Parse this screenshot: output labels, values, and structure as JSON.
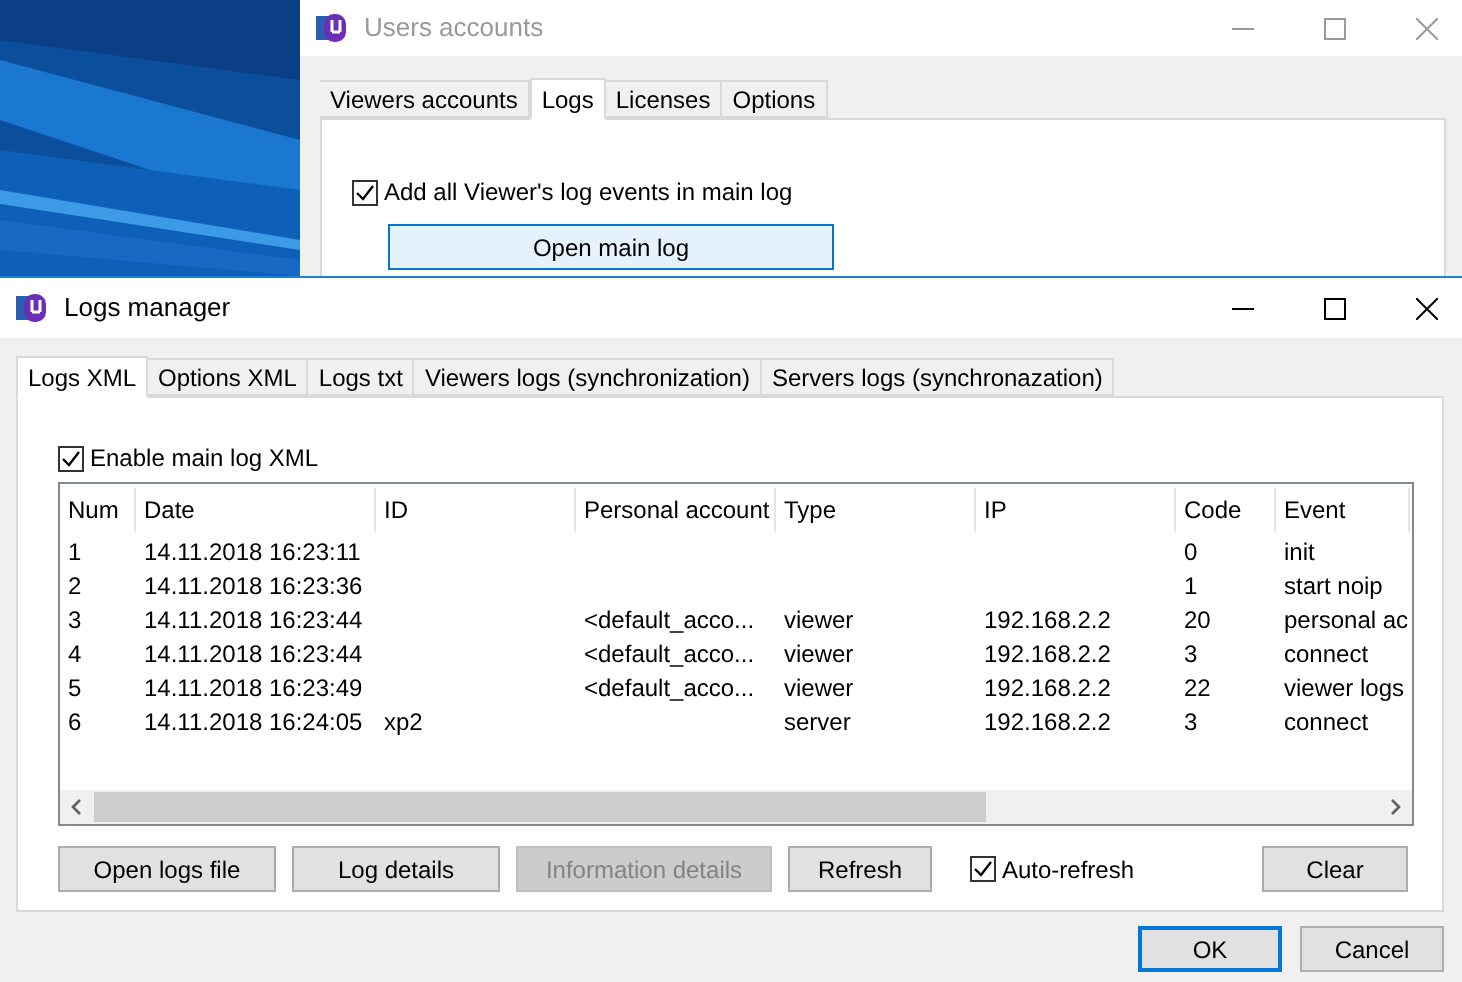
{
  "background_window": {
    "title": "Users accounts",
    "tabs": [
      {
        "label": "Viewers accounts",
        "selected": false
      },
      {
        "label": "Logs",
        "selected": true
      },
      {
        "label": "Licenses",
        "selected": false
      },
      {
        "label": "Options",
        "selected": false
      }
    ],
    "checkbox": {
      "label": "Add all Viewer's log events in main log",
      "checked": true
    },
    "button": "Open main log"
  },
  "window": {
    "title": "Logs manager",
    "tabs": [
      {
        "label": "Logs XML",
        "selected": true
      },
      {
        "label": "Options XML",
        "selected": false
      },
      {
        "label": "Logs txt",
        "selected": false
      },
      {
        "label": "Viewers logs (synchronization)",
        "selected": false
      },
      {
        "label": "Servers logs (synchronazation)",
        "selected": false
      }
    ],
    "enable_checkbox": {
      "label": "Enable main log XML",
      "checked": true
    },
    "table": {
      "columns": [
        "Num",
        "Date",
        "ID",
        "Personal account",
        "Type",
        "IP",
        "Code",
        "Event"
      ],
      "rows": [
        [
          "1",
          "14.11.2018 16:23:11",
          null,
          null,
          null,
          null,
          "0",
          "init"
        ],
        [
          "2",
          "14.11.2018 16:23:36",
          null,
          null,
          null,
          null,
          "1",
          "start noip"
        ],
        [
          "3",
          "14.11.2018 16:23:44",
          null,
          "<default_acco...",
          "viewer",
          "192.168.2.2",
          "20",
          "personal ac"
        ],
        [
          "4",
          "14.11.2018 16:23:44",
          null,
          "<default_acco...",
          "viewer",
          "192.168.2.2",
          "3",
          "connect"
        ],
        [
          "5",
          "14.11.2018 16:23:49",
          null,
          "<default_acco...",
          "viewer",
          "192.168.2.2",
          "22",
          "viewer logs"
        ],
        [
          "6",
          "14.11.2018 16:24:05",
          "xp2",
          null,
          "server",
          "192.168.2.2",
          "3",
          "connect"
        ]
      ]
    },
    "actions": [
      {
        "kind": "button",
        "label": "Open logs file",
        "disabled": false
      },
      {
        "kind": "button",
        "label": "Log details",
        "disabled": false
      },
      {
        "kind": "button",
        "label": "Information details",
        "disabled": true
      },
      {
        "kind": "button",
        "label": "Refresh",
        "disabled": false
      },
      {
        "kind": "checkbox",
        "label": "Auto-refresh",
        "checked": true
      },
      {
        "kind": "button",
        "label": "Clear",
        "disabled": false
      }
    ],
    "dialog_buttons": [
      {
        "label": "OK",
        "default": true
      },
      {
        "label": "Cancel",
        "default": false
      }
    ]
  }
}
